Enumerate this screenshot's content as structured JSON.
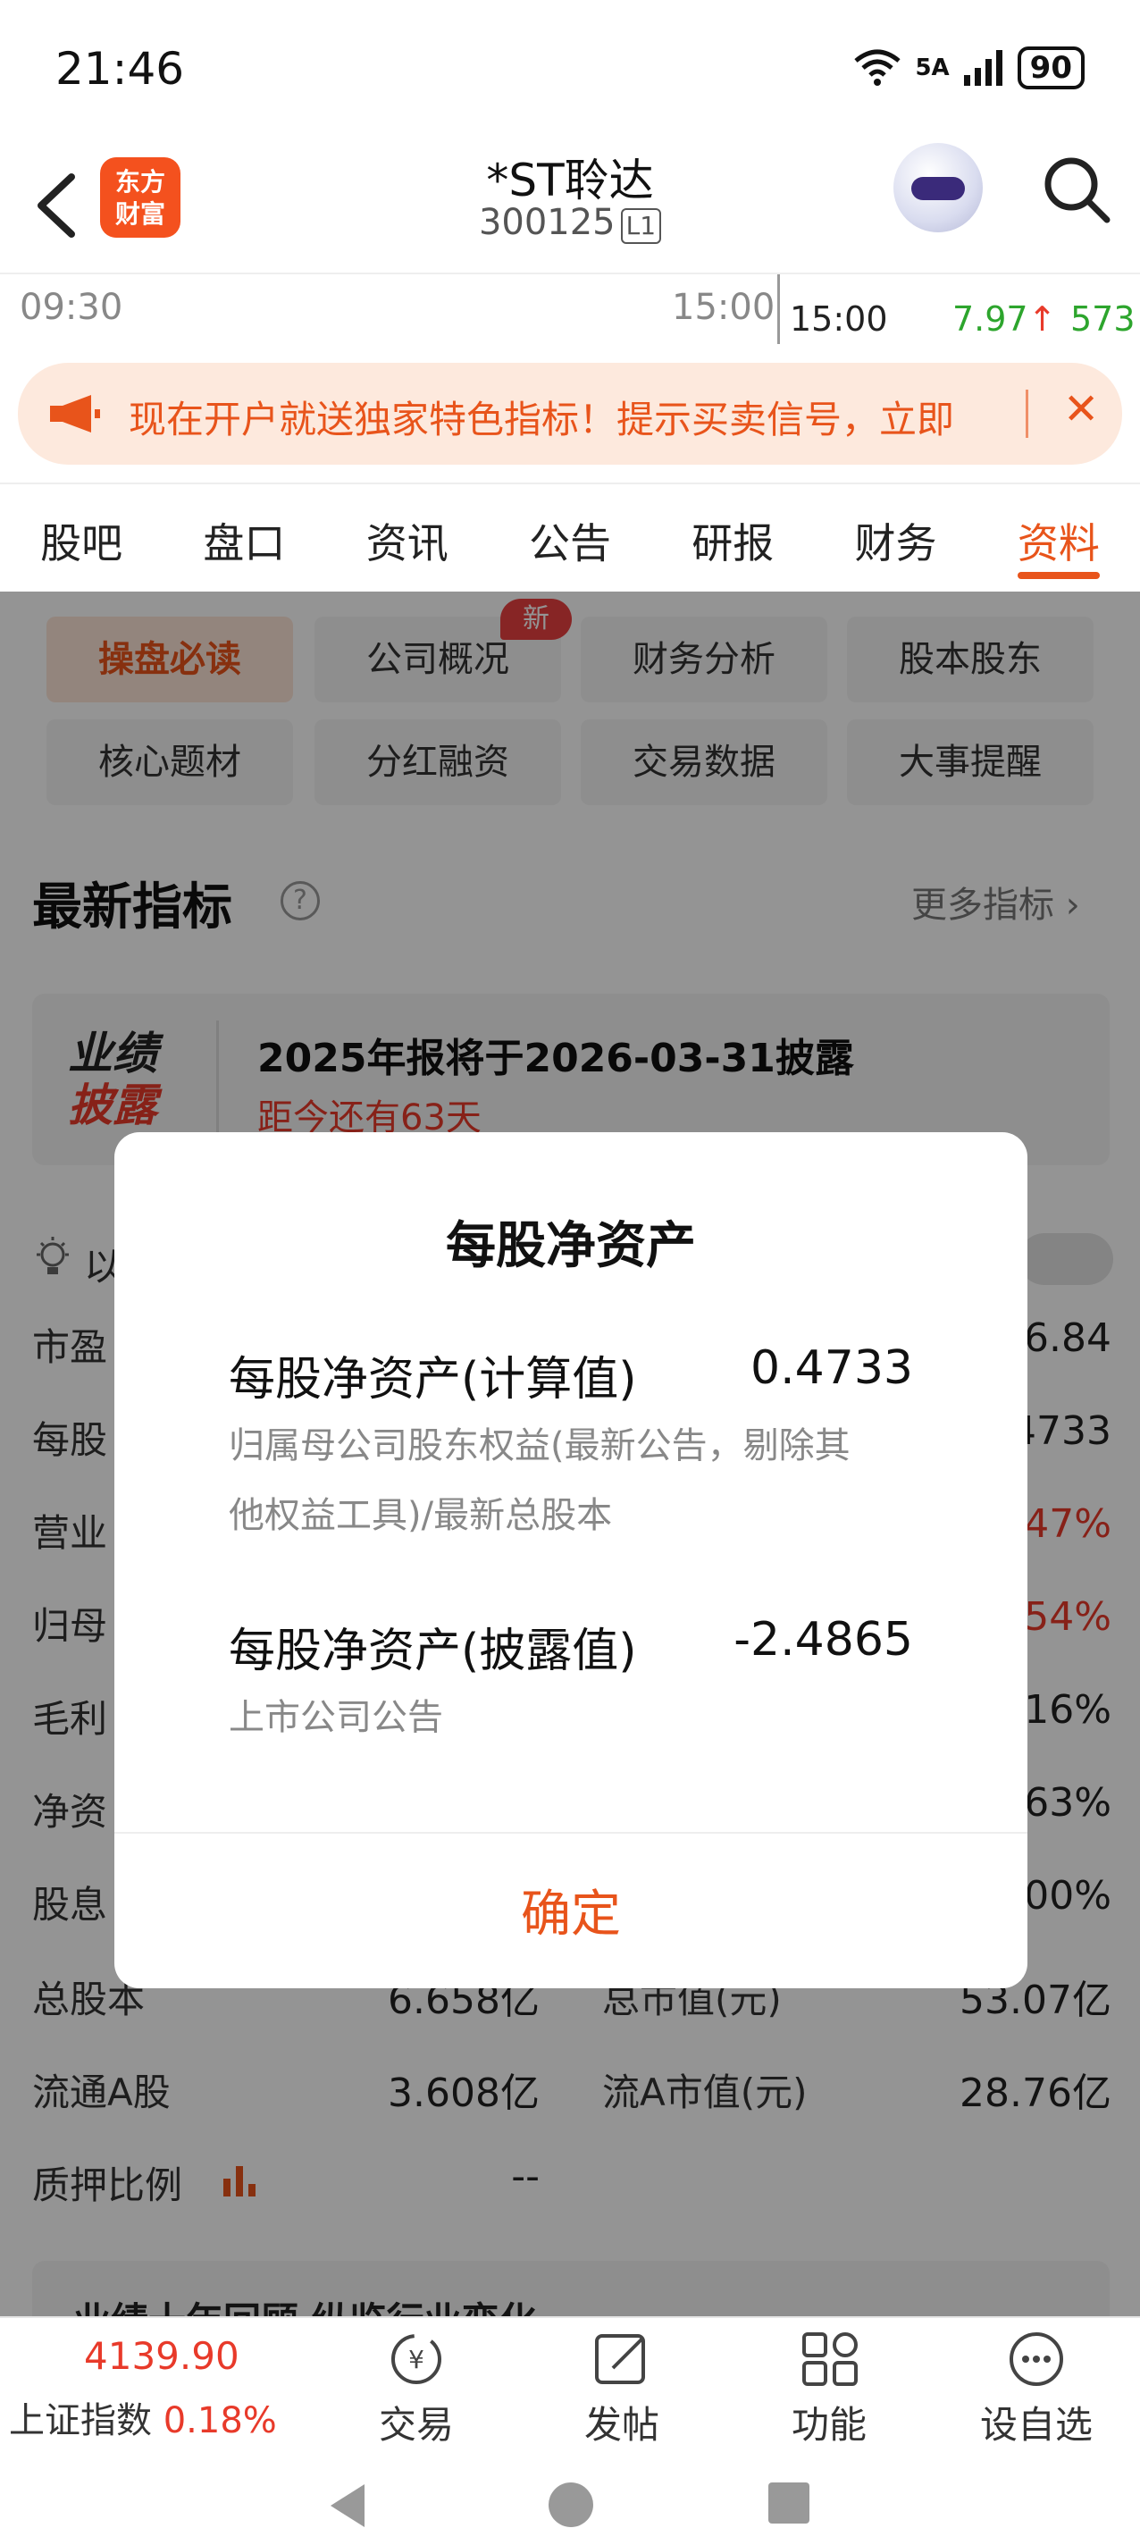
{
  "status_bar": {
    "time": "21:46",
    "network": "5A",
    "battery": "90"
  },
  "header": {
    "title": "*ST聆达",
    "code": "300125",
    "level": "L1",
    "logo_text": "东方财富"
  },
  "chart_strip": {
    "start_time": "09:30",
    "end_time": "15:00",
    "tick_time": "15:00",
    "tick_price": "7.97",
    "tick_volume": "573"
  },
  "promo": {
    "text": "现在开户就送独家特色指标！提示买卖信号，立即"
  },
  "tabs": [
    "股吧",
    "盘口",
    "资讯",
    "公告",
    "研报",
    "财务",
    "资料"
  ],
  "active_tab": "资料",
  "subtabs": {
    "items": [
      "操盘必读",
      "公司概况",
      "财务分析",
      "股本股东",
      "核心题材",
      "分红融资",
      "交易数据",
      "大事提醒"
    ],
    "active": "操盘必读",
    "new_badge": "新"
  },
  "section": {
    "title": "最新指标",
    "more_label": "更多指标"
  },
  "perf": {
    "label_line1": "业绩",
    "label_line2": "披露",
    "headline": "2025年报将于2026-03-31披露",
    "countdown": "距今还有63天"
  },
  "notice_prefix": "以",
  "indicators": {
    "left_labels": [
      "市盈",
      "每股",
      "营业",
      "归母",
      "毛利",
      "净资",
      "股息"
    ],
    "right_values": [
      "6.84",
      "4733",
      "47%",
      "54%",
      "16%",
      "63%",
      "00%"
    ],
    "rows": [
      {
        "label1": "总股本",
        "value1": "6.658亿",
        "label2": "总市值(元)",
        "value2": "53.07亿"
      },
      {
        "label1": "流通A股",
        "value1": "3.608亿",
        "label2": "流A市值(元)",
        "value2": "28.76亿"
      },
      {
        "label1": "质押比例",
        "value1": "--",
        "label2": "",
        "value2": ""
      }
    ],
    "next_section_partial": "业绩十年回顾  纵览行业变化"
  },
  "dialog": {
    "title": "每股净资产",
    "items": [
      {
        "name": "每股净资产(计算值)",
        "value": "0.4733",
        "desc_line1": "归属母公司股东权益(最新公告，剔除其",
        "desc_line2": "他权益工具)/最新总股本"
      },
      {
        "name": "每股净资产(披露值)",
        "value": "-2.4865",
        "desc_line1": "上市公司公告",
        "desc_line2": ""
      }
    ],
    "confirm_label": "确定"
  },
  "bottom_bar": {
    "index_value": "4139.90",
    "index_name": "上证指数",
    "index_change": "0.18%",
    "items": [
      "交易",
      "发帖",
      "功能",
      "设自选"
    ]
  },
  "colors": {
    "accent": "#e8541b",
    "up": "#e83a2a",
    "down": "#2da52d"
  }
}
